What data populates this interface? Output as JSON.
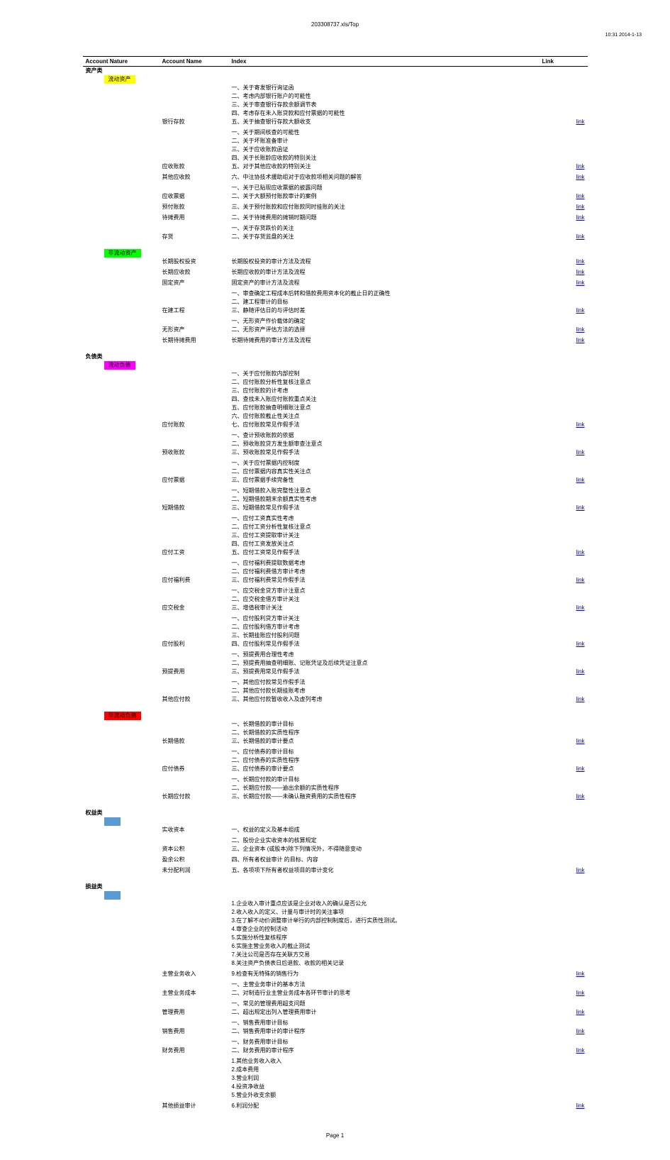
{
  "header": {
    "title": "203308737.xls/Top"
  },
  "top_right": "10:31  2014-1-13",
  "footer": "Page 1",
  "columns": {
    "nature": "Account Nature",
    "name": "Account Name",
    "index": "Index",
    "link": "Link"
  },
  "linkText": "link",
  "sections": [
    {
      "cat": {
        "label": "资产类",
        "style": "bold"
      },
      "sub": {
        "label": "流动资产",
        "style": "hlYellow"
      },
      "rows": [
        {
          "name": "银行存款",
          "idx": [
            "一、关于寄发银行询证函",
            "二、考虑内部银行账户的可能性",
            "三、关于审查银行存款余额调节表",
            "四、考虑存在未入账贷款和应付票据的可能性",
            "五、关于抽查银行存款大额收支"
          ],
          "link": true
        },
        {
          "name": "应收账款",
          "idx": [
            "一、关于期间核查的可能性",
            "二、关于坏账准备审计",
            "三、关于应收账款函证",
            "四、关于长账龄应收款的特别关注",
            "五、对于其他应收款的特别关注"
          ],
          "link": true
        },
        {
          "name": "其他应收款",
          "idx": [
            "六、中注协技术援助组对于应收款项相关问题的解答"
          ],
          "link": true
        },
        {
          "name": "应收票据",
          "idx": [
            "一、关于已贴现应收票据的披露问题",
            "二、关于大额预付账款审计的案例"
          ],
          "link": true
        },
        {
          "name": "预付账款",
          "idx": [
            "三、关于预付账款和应付账款同时挂账的关注"
          ],
          "link": true
        },
        {
          "name": "待摊费用",
          "idx": [
            "二、关于待摊费用的摊销时期问题"
          ],
          "link": true
        },
        {
          "name": "存货",
          "idx": [
            "一、关于存货跌价的关注",
            "二、关于存货监盘的关注"
          ],
          "link": true
        }
      ]
    },
    {
      "sub": {
        "label": "非流动资产",
        "style": "hlGreen"
      },
      "rows": [
        {
          "name": "长期股权投资",
          "idx": [
            "长期股权投资的审计方法及流程"
          ],
          "link": true
        },
        {
          "name": "长期应收款",
          "idx": [
            "长期应收款的审计方法及流程"
          ],
          "link": true
        },
        {
          "name": "固定资产",
          "idx": [
            "固定资产的审计方法及流程"
          ],
          "link": true
        },
        {
          "name": "在建工程",
          "idx": [
            "一、审查确定工程成本后转和借款费用资本化的截止日的正确性",
            "二、建工程审计的目标",
            "三、静随评估日的与评估时差"
          ],
          "link": true
        },
        {
          "name": "无形资产",
          "idx": [
            "一、无形资产作价载体的确定",
            "二、无形资产评估方法的选择"
          ],
          "link": true
        },
        {
          "name": "长期待摊费用",
          "idx": [
            "长期待摊费用的审计方法及流程"
          ],
          "link": true
        }
      ]
    },
    {
      "cat": {
        "label": "负债类",
        "style": "bold"
      },
      "sub": {
        "label": "流动负债",
        "style": "hlMagenta"
      },
      "rows": [
        {
          "name": "应付账款",
          "idx": [
            "一、关于应付账款内部控制",
            "二、应付账款分析性复核注意点",
            "三、应付账款的计考虑",
            "四、查找未入账应付账款重点关注",
            "五、应付账款抽查明细账注意点",
            "六、应付账款截止性关注点",
            "七、应付账款常见作假手法"
          ],
          "link": true
        },
        {
          "name": "预收账款",
          "idx": [
            "一、查计预收账款的依据",
            "二、预收账款贷方发生额审查注意点",
            "三、预收账款常见作假手法"
          ],
          "link": true
        },
        {
          "name": "应付票据",
          "idx": [
            "一、关于应付票据内控制度",
            "二、应付票据内容真实性关注点",
            "三、应付票据手续完备性"
          ],
          "link": true
        },
        {
          "name": "短期借款",
          "idx": [
            "一、短期借款入账完整性注意点",
            "二、短期借款期末余额真实性考虑",
            "三、短期借款常见作假手法"
          ],
          "link": true
        },
        {
          "name": "应付工资",
          "idx": [
            "一、应付工资真实性考虑",
            "二、应付工资分析性复核注意点",
            "三、应付工资提取审计关注",
            "四、应付工资发放关注点",
            "五、应付工资常见作假手法"
          ],
          "link": true
        },
        {
          "name": "应付福利费",
          "idx": [
            "一、应付福利费提取数据考虑",
            "二、应付福利费借方审计考虑",
            "三、应付福利费常见作假手法"
          ],
          "link": true
        },
        {
          "name": "应交税金",
          "idx": [
            "一、应交税金贷方审计注意点",
            "二、应交税金借方审计关注",
            "三、增值税审计关注"
          ],
          "link": true
        },
        {
          "name": "应付股利",
          "idx": [
            "一、应付股利贷方审计关注",
            "二、应付股利借方审计考虑",
            "三、长期挂账应付股利问题",
            "四、应付股利常见作假手法"
          ],
          "link": true
        },
        {
          "name": "预提费用",
          "idx": [
            "一、预提费用合理性考虑",
            "二、预提费用抽查明细账、记账凭证及后续凭证注意点",
            "三、预提费用常见作假手法"
          ],
          "link": true
        },
        {
          "name": "其他应付款",
          "idx": [
            "一、其他应付款常见作假手法",
            "二、其他应付款长期挂账考虑",
            "三、其他应付款暂收收入及虚列考虑"
          ],
          "link": true
        }
      ]
    },
    {
      "sub": {
        "label": "非流动负债",
        "style": "hlRed"
      },
      "rows": [
        {
          "name": "长期借款",
          "idx": [
            "一、长期借款的审计目标",
            "二、长期借款的实质性程序",
            "三、长期借款的审计要点"
          ],
          "link": true
        },
        {
          "name": "应付债券",
          "idx": [
            "一、应付债券的审计目标",
            "二、应付债券的实质性程序",
            "三、应付债券的审计要点"
          ],
          "link": true
        },
        {
          "name": "长期应付款",
          "idx": [
            "一、长期应付款的审计目标",
            "二、长期应付款——逾出余额的实质性程序",
            "三、长期应付款——未确认融资费用的实质性程序"
          ],
          "link": true
        }
      ]
    },
    {
      "cat": {
        "label": "权益类",
        "style": "bold"
      },
      "sub": {
        "label": "",
        "style": "hlBlue"
      },
      "rows": [
        {
          "name": "实收资本",
          "idx": [
            "一、权益的定义及基本组成"
          ],
          "link": false
        },
        {
          "name": "资本公积",
          "idx": [
            "二、股份企业实收资本的核算规定",
            "三、企业资本 (或股本)除下列情况外，不得随意变动"
          ],
          "link": false
        },
        {
          "name": "盈余公积",
          "idx": [
            "四、所有者权益审计 的目标、内容"
          ],
          "link": false
        },
        {
          "name": "未分配利润",
          "idx": [
            "五、各项项下所有者权益项目的审计变化"
          ],
          "link": true
        }
      ]
    },
    {
      "cat": {
        "label": "损益类",
        "style": "bold"
      },
      "sub": {
        "label": "",
        "style": "hlBlue"
      },
      "rows": [
        {
          "name": "",
          "idx": [
            "1.企业收入审计重点应该是企业对收入的确认是否公允",
            "2.收入收入的定义、计量与审计时的关注事项",
            "3.在了解不动价调整审计举行的内部控制制度后，进行实质性测试。",
            "4.审查企业的控制活动",
            "5.实施分析性复核程序",
            "6.实施主营业务收入的截止测试",
            "7.关注公司是否存在关联方交易",
            "8.关注资产负债表日后退款、收款的相关记录"
          ],
          "link": false
        },
        {
          "name": "主营业务收入",
          "idx": [
            "9.检查有无特殊的销售行为"
          ],
          "link": true
        },
        {
          "name": "主营业务成本",
          "idx": [
            "一、主营业务审计的基本方法",
            "二、对制造行业主营业务成本各环节审计的思考"
          ],
          "link": true
        },
        {
          "name": "管理费用",
          "idx": [
            "一、常见的管理费用超支问题",
            "二、超出规定出列入管理费用审计"
          ],
          "link": true
        },
        {
          "name": "销售费用",
          "idx": [
            "一、销售费用审计目标",
            "二、销售费用审计的审计程序"
          ],
          "link": true
        },
        {
          "name": "财务费用",
          "idx": [
            "一、财务费用审计目标",
            "二、财务费用的审计程序"
          ],
          "link": true
        },
        {
          "name": "",
          "idx": [
            "1.其他业务收入收入",
            "2.成本费用",
            "3.营业利润",
            "4.投资净收益",
            "5.营业外收支余额"
          ],
          "link": false
        },
        {
          "name": "其他损益审计",
          "idx": [
            "6.利润分配"
          ],
          "link": true
        }
      ]
    }
  ]
}
